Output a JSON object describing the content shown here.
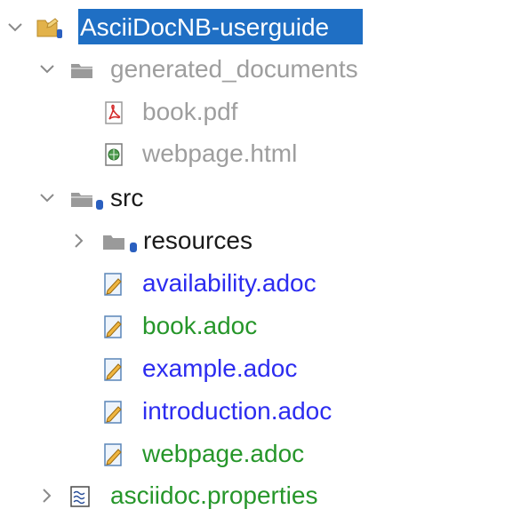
{
  "tree": {
    "root": {
      "label": "AsciiDocNB-userguide",
      "icon": "project-folder-icon",
      "expanded": true,
      "selected": true,
      "color": "#ffffff"
    },
    "items": [
      {
        "label": "generated_documents",
        "icon": "folder-icon",
        "expanded": true,
        "color": "#9e9e9e"
      },
      {
        "label": "book.pdf",
        "icon": "pdf-file-icon",
        "color": "#9e9e9e"
      },
      {
        "label": "webpage.html",
        "icon": "html-file-icon",
        "color": "#9e9e9e"
      },
      {
        "label": "src",
        "icon": "versioned-folder-icon",
        "expanded": true,
        "color": "#1a1a1a"
      },
      {
        "label": "resources",
        "icon": "versioned-folder-icon",
        "expanded": false,
        "color": "#1a1a1a"
      },
      {
        "label": "availability.adoc",
        "icon": "edit-document-icon",
        "color": "#2c2cf0"
      },
      {
        "label": "book.adoc",
        "icon": "edit-document-icon",
        "color": "#26962a"
      },
      {
        "label": "example.adoc",
        "icon": "edit-document-icon",
        "color": "#2c2cf0"
      },
      {
        "label": "introduction.adoc",
        "icon": "edit-document-icon",
        "color": "#2c2cf0"
      },
      {
        "label": "webpage.adoc",
        "icon": "edit-document-icon",
        "color": "#26962a"
      },
      {
        "label": "asciidoc.properties",
        "icon": "properties-file-icon",
        "expanded": false,
        "color": "#26962a"
      }
    ]
  },
  "colors": {
    "selection": "#1f6fc4",
    "chevron": "#8a8a8a"
  }
}
